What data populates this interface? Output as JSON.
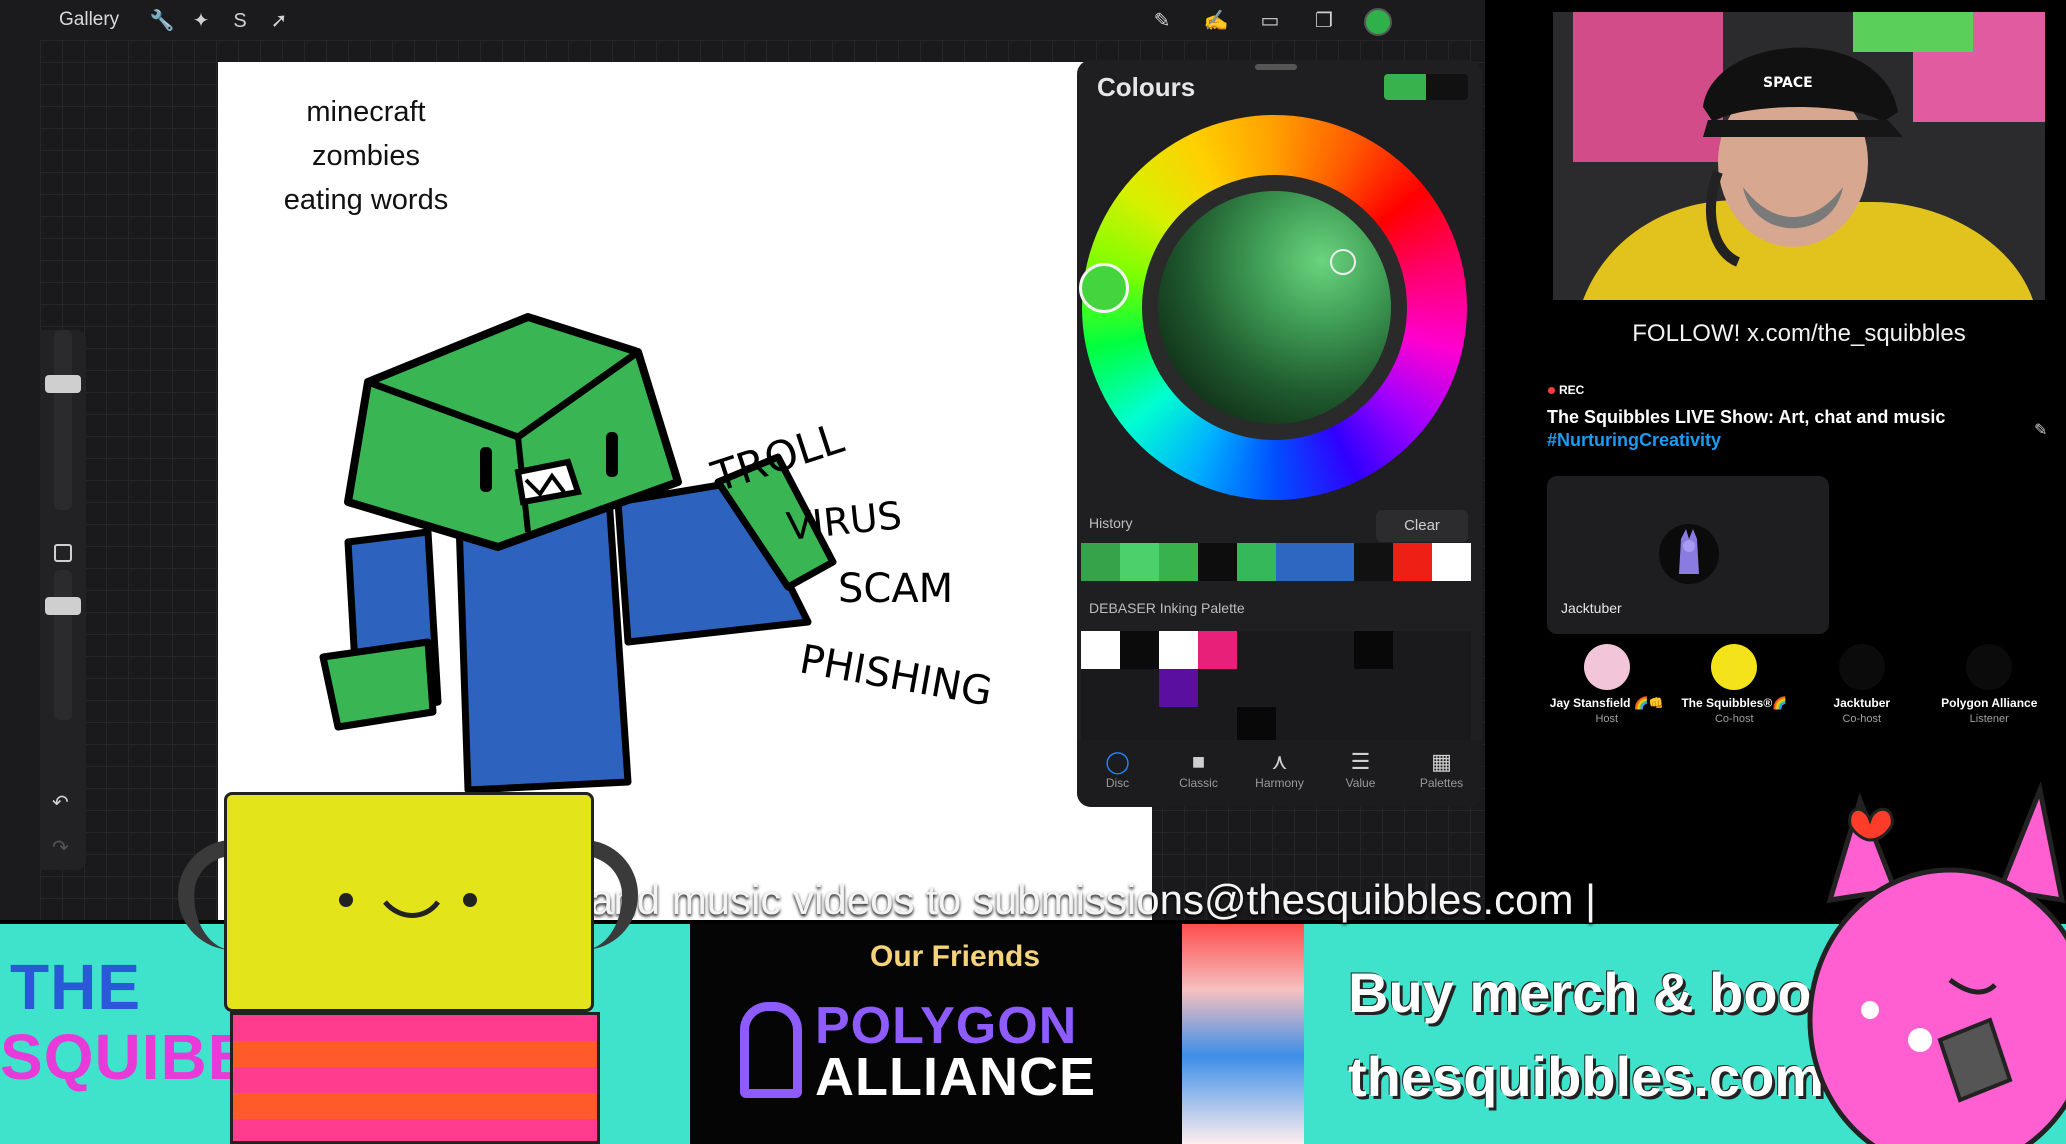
{
  "procreate": {
    "gallery_label": "Gallery",
    "toolbar_icons": [
      "wrench-icon",
      "magic-wand-icon",
      "selection-icon",
      "transform-arrow-icon"
    ],
    "tool_icons": [
      "brush-icon",
      "smudge-icon",
      "eraser-icon",
      "layers-icon"
    ],
    "active_color": "#2fb04b"
  },
  "canvas": {
    "note_lines": [
      "minecraft",
      "zombies",
      "eating words"
    ],
    "words": [
      "TROLL",
      "VIRUS",
      "SCAM",
      "PHISHING"
    ]
  },
  "colours_panel": {
    "title": "Colours",
    "history_label": "History",
    "clear_label": "Clear",
    "history_swatches": [
      "#36a24a",
      "#4bd16b",
      "#37b24d",
      "#0d0d0d",
      "#34b85a",
      "#2e67c2",
      "#2e67c2",
      "#111111",
      "#ee2015",
      "#ffffff"
    ],
    "palette_label": "DEBASER Inking Palette",
    "palette_swatches": [
      "#ffffff",
      "#0b0b0b",
      "#ffffff",
      "#e8207a",
      "#1a1a1c",
      "#1a1a1c",
      "#1a1a1c",
      "#080808",
      "#1a1a1c",
      "#1a1a1c",
      "#1a1a1c",
      "#1a1a1c",
      "#5a0f9e",
      "#1a1a1c",
      "#1a1a1c",
      "#1a1a1c",
      "#1a1a1c",
      "#1a1a1c",
      "#1a1a1c",
      "#1a1a1c",
      "#1a1a1c",
      "#1a1a1c",
      "#1a1a1c",
      "#1a1a1c",
      "#080808",
      "#1a1a1c",
      "#1a1a1c",
      "#1a1a1c",
      "#1a1a1c",
      "#1a1a1c"
    ],
    "tabs": [
      {
        "label": "Disc",
        "icon": "disc-icon",
        "active": true
      },
      {
        "label": "Classic",
        "icon": "classic-square-icon",
        "active": false
      },
      {
        "label": "Harmony",
        "icon": "harmony-icon",
        "active": false
      },
      {
        "label": "Value",
        "icon": "value-sliders-icon",
        "active": false
      },
      {
        "label": "Palettes",
        "icon": "palettes-grid-icon",
        "active": false
      }
    ]
  },
  "stream": {
    "follow_text": "FOLLOW! x.com/the_squibbles",
    "rec_label": "REC",
    "show_title": "The Squibbles LIVE Show: Art, chat and music",
    "show_hashtag": "#NurturingCreativity",
    "active_speaker": "Jacktuber",
    "participants": [
      {
        "name": "Jay Stansfield 🌈👊",
        "role": "Host",
        "color": "#f2c6d8"
      },
      {
        "name": "The Squibbles®🌈",
        "role": "Co-host",
        "color": "#f4e21b"
      },
      {
        "name": "Jacktuber",
        "role": "Co-host",
        "color": "#0b0b0c"
      },
      {
        "name": "Polygon Alliance",
        "role": "Listener",
        "color": "#0b0b0c"
      }
    ]
  },
  "banner": {
    "ticker_text": "and music videos to submissions@thesquibbles.com |",
    "logo_line1": "THE",
    "logo_line2": "SQUIBBLES",
    "logo_reg": "R",
    "friends_heading": "Our Friends",
    "friends_name1": "POLYGON",
    "friends_name2": "ALLIANCE",
    "merch_line1": "Buy merch & books",
    "merch_line2": "thesquibbles.com"
  }
}
